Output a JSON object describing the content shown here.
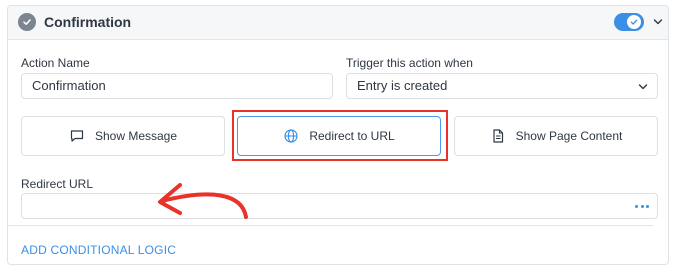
{
  "header": {
    "title": "Confirmation",
    "enabled": true
  },
  "action_name": {
    "label": "Action Name",
    "value": "Confirmation"
  },
  "trigger": {
    "label": "Trigger this action when",
    "selected": "Entry is created"
  },
  "confirmation_types": [
    {
      "label": "Show Message",
      "icon": "speech-bubble-icon",
      "active": false
    },
    {
      "label": "Redirect to URL",
      "icon": "globe-icon",
      "active": true
    },
    {
      "label": "Show Page Content",
      "icon": "document-icon",
      "active": false
    }
  ],
  "redirect_url": {
    "label": "Redirect URL",
    "value": ""
  },
  "conditional_logic_link": "ADD CONDITIONAL LOGIC",
  "colors": {
    "accent": "#3b8fe4",
    "highlight_annotation": "#e8322a"
  }
}
